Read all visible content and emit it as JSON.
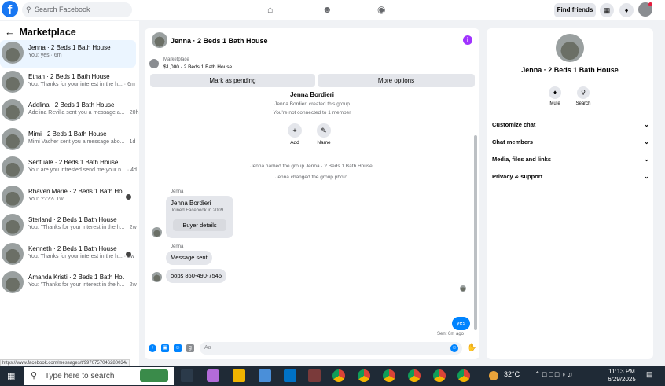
{
  "topbar": {
    "search_placeholder": "Search Facebook",
    "find_friends": "Find friends"
  },
  "left": {
    "header": "Marketplace",
    "conversations": [
      {
        "name": "Jenna · 2 Beds 1 Bath House",
        "snippet": "You: yes · 6m"
      },
      {
        "name": "Ethan · 2 Beds 1 Bath House",
        "snippet": "You: Thanks for your interest in the h... · 6m"
      },
      {
        "name": "Adelina · 2 Beds 1 Bath House",
        "snippet": "Adelina Revilla sent you a message a... · 20h"
      },
      {
        "name": "Mimi · 2 Beds 1 Bath House",
        "snippet": "Mimi Vacher sent you a message abo... · 1d"
      },
      {
        "name": "Sentuale · 2 Beds 1 Bath House",
        "snippet": "You: are you intrested send me your n... · 4d"
      },
      {
        "name": "Rhaven Marie · 2 Beds 1 Bath Ho...",
        "snippet": "You: ????· 1w"
      },
      {
        "name": "Sterland · 2 Beds 1 Bath House",
        "snippet": "You: \"Thanks for your interest in the h... · 2w"
      },
      {
        "name": "Kenneth · 2 Beds 1 Bath House",
        "snippet": "You: Thanks for your interest in the h... · 2w"
      },
      {
        "name": "Amanda Kristi · 2 Beds 1 Bath House",
        "snippet": "You: \"Thanks for your interest in the h... · 2w"
      }
    ],
    "status_url": "https://www.facebook.com/messages/t/9970757046280034/"
  },
  "chat": {
    "title": "Jenna · 2 Beds 1 Bath House",
    "marketplace_label": "Marketplace",
    "listing": "$1,000 · 2 Beds 1 Bath House",
    "mark_pending": "Mark as pending",
    "more_options": "More options",
    "group_name": "Jenna Bordieri",
    "created_text": "Jenna Bordieri created this group",
    "not_connected": "You're not connected to 1 member",
    "add_label": "Add",
    "name_label": "Name",
    "named_event": "Jenna named the group Jenna · 2 Beds 1 Bath House.",
    "photo_event": "Jenna changed the group photo.",
    "sender1": "Jenna",
    "card_name": "Jenna Bordieri",
    "card_sub": "Joined Facebook in 2009",
    "buyer_details": "Buyer details",
    "sender2": "Jenna",
    "msg_sent": "Message sent",
    "msg_phone": "oops 860-490-7546",
    "my_msg": "yes",
    "sent_time": "Sent 6m ago",
    "composer_placeholder": "Aa"
  },
  "right": {
    "name": "Jenna · 2 Beds 1 Bath House",
    "mute": "Mute",
    "search": "Search",
    "sections": [
      "Customize chat",
      "Chat members",
      "Media, files and links",
      "Privacy & support"
    ]
  },
  "taskbar": {
    "search_placeholder": "Type here to search",
    "temperature": "32°C",
    "time": "11:13 PM",
    "date": "6/29/2025"
  }
}
